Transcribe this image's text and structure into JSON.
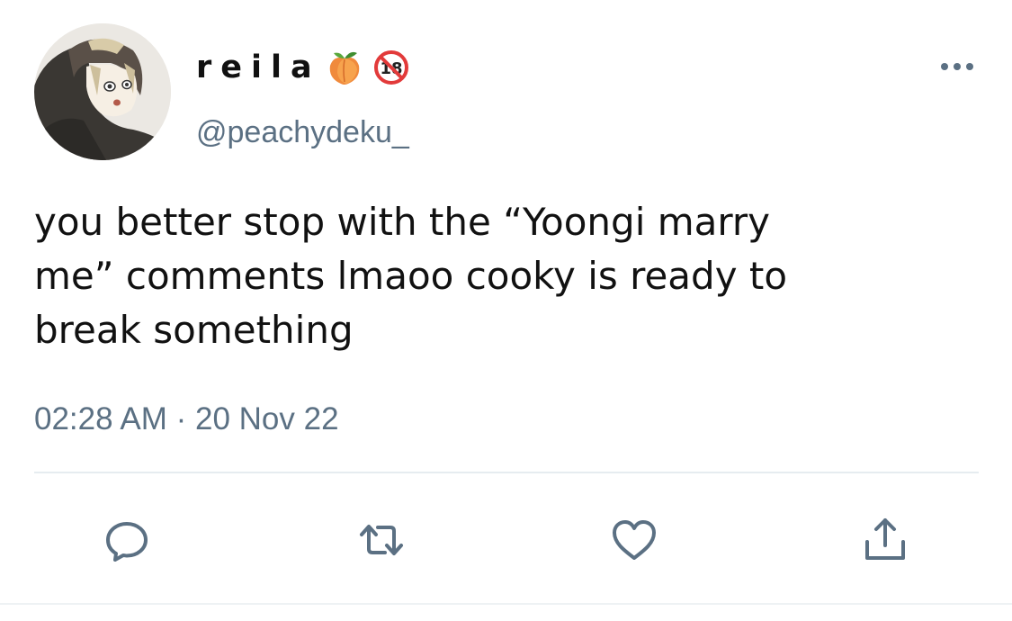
{
  "tweet": {
    "display_name": "reila",
    "badges": [
      "peach-emoji",
      "no-under-18-emoji"
    ],
    "handle": "@peachydeku_",
    "text_lines": [
      "you better stop with the “Yoongi marry",
      "me” comments lmaoo cooky is ready to",
      "break something"
    ],
    "timestamp": "02:28 AM · 20 Nov 22"
  },
  "actions": [
    {
      "icon": "reply-icon"
    },
    {
      "icon": "retweet-icon"
    },
    {
      "icon": "like-icon"
    },
    {
      "icon": "share-icon"
    }
  ],
  "colors": {
    "secondary_text": "#5b7083",
    "icon": "#5b7083",
    "primary_text": "#111111",
    "divider": "#e6ecf0"
  }
}
